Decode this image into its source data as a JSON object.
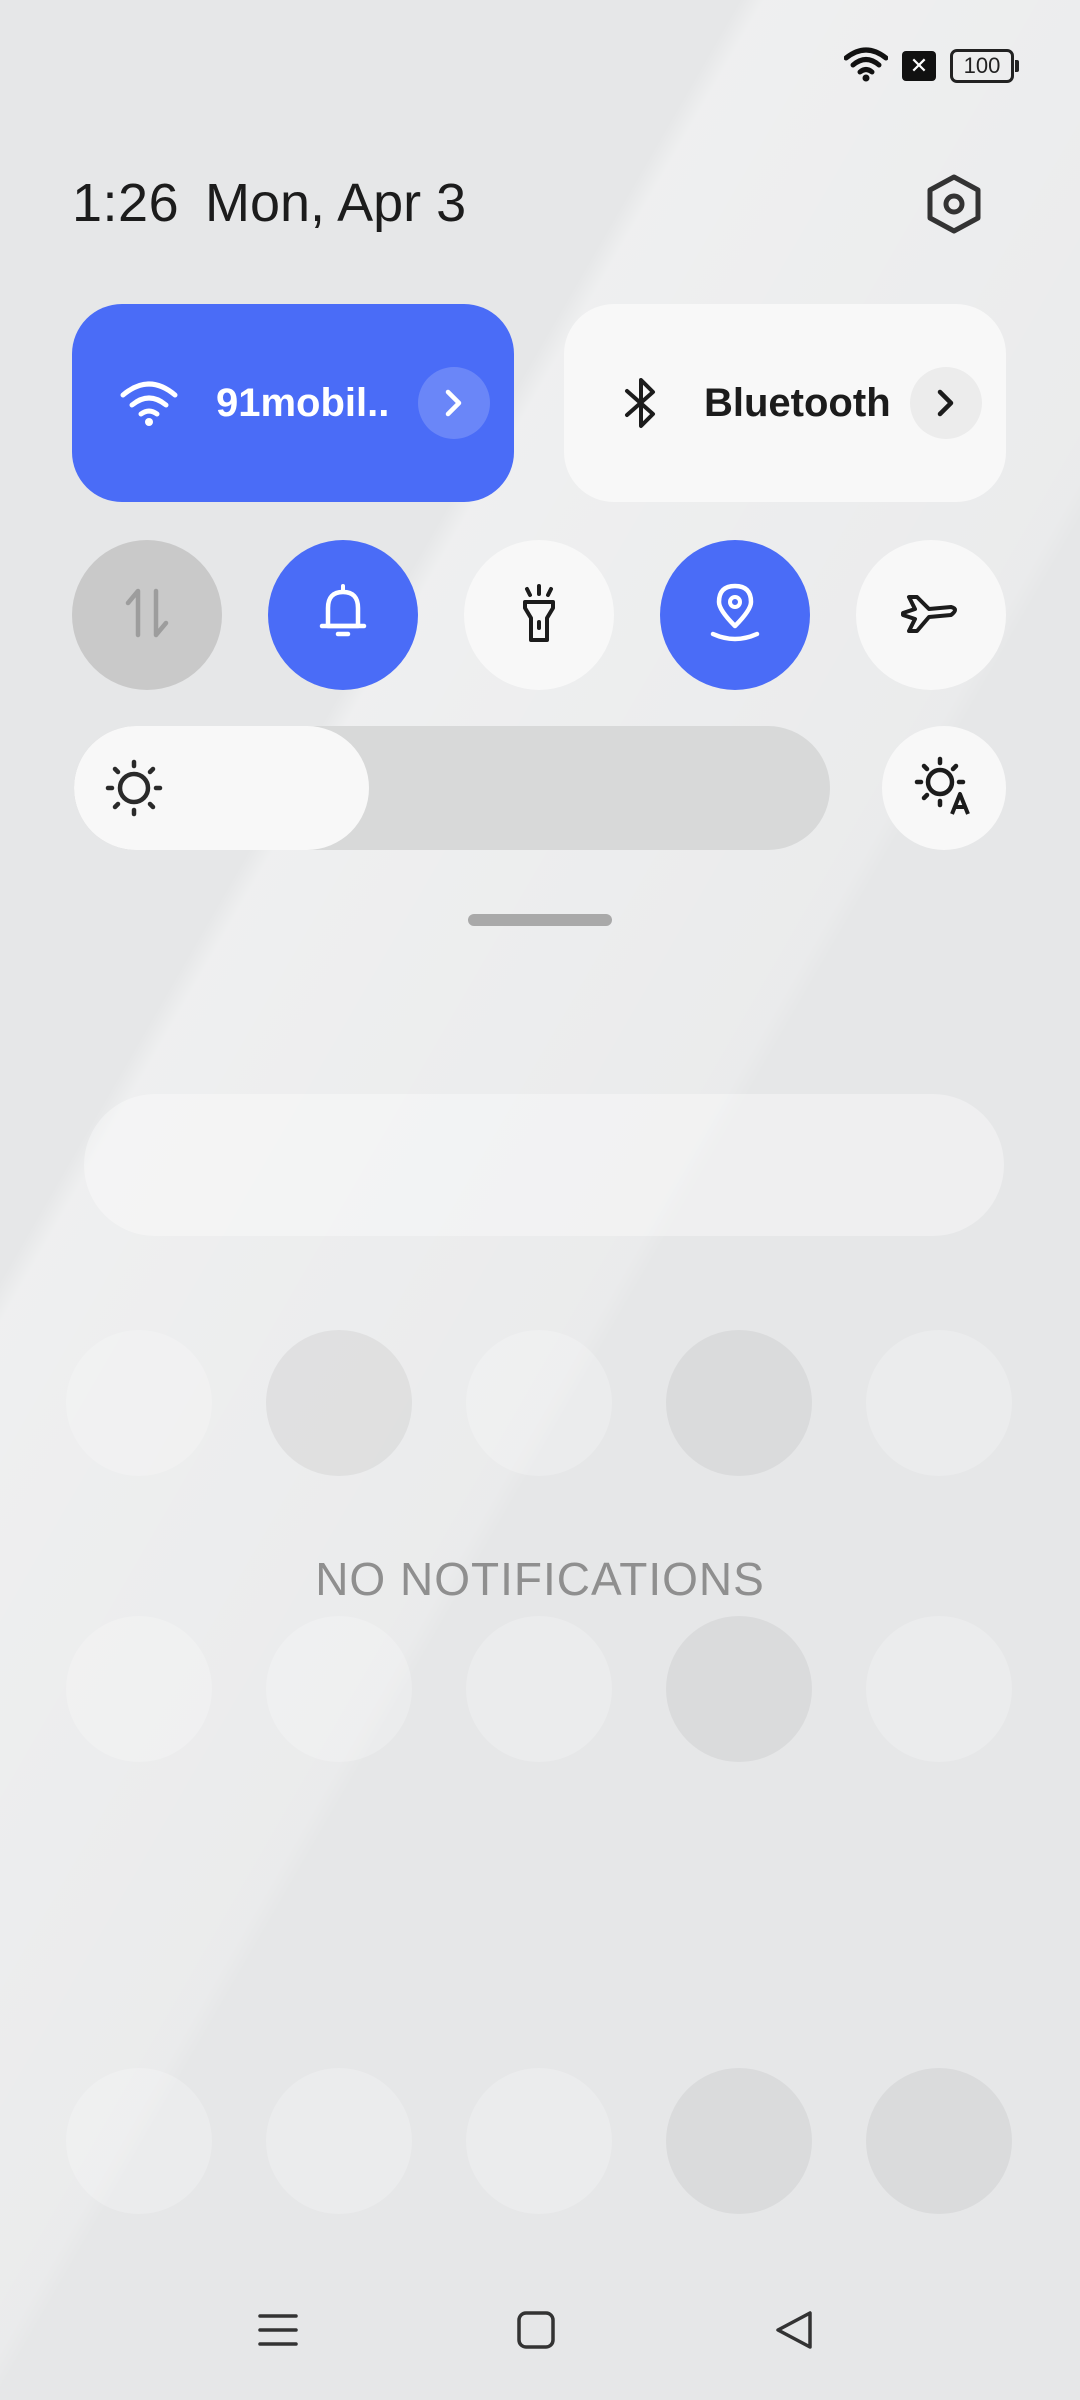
{
  "status_bar": {
    "battery": "100",
    "icons": [
      "wifi-icon",
      "sim-x-icon",
      "battery-icon"
    ],
    "sim_mark": "✕"
  },
  "header": {
    "time": "1:26",
    "date": "Mon, Apr 3",
    "settings_icon": "settings-hex-icon"
  },
  "tiles": {
    "wifi": {
      "label": "91mobil..",
      "icon": "wifi-icon",
      "active": true
    },
    "bluetooth": {
      "label": "Bluetooth",
      "icon": "bluetooth-icon",
      "active": false
    }
  },
  "toggles": [
    {
      "name": "mobile-data",
      "icon": "data-arrows-icon",
      "state": "off"
    },
    {
      "name": "sound",
      "icon": "bell-icon",
      "state": "on"
    },
    {
      "name": "flashlight",
      "icon": "flashlight-icon",
      "state": "off"
    },
    {
      "name": "location",
      "icon": "location-pin-icon",
      "state": "on"
    },
    {
      "name": "airplane-mode",
      "icon": "airplane-icon",
      "state": "off"
    }
  ],
  "brightness": {
    "level": 0.39,
    "auto_icon": "auto-brightness-icon"
  },
  "notifications": {
    "empty_text": "NO NOTIFICATIONS"
  },
  "nav": [
    "menu-icon",
    "home-icon",
    "back-icon"
  ],
  "colors": {
    "accent": "#4a6cf7",
    "background": "#e6e7e8",
    "tile_light": "#f8f8f8"
  }
}
